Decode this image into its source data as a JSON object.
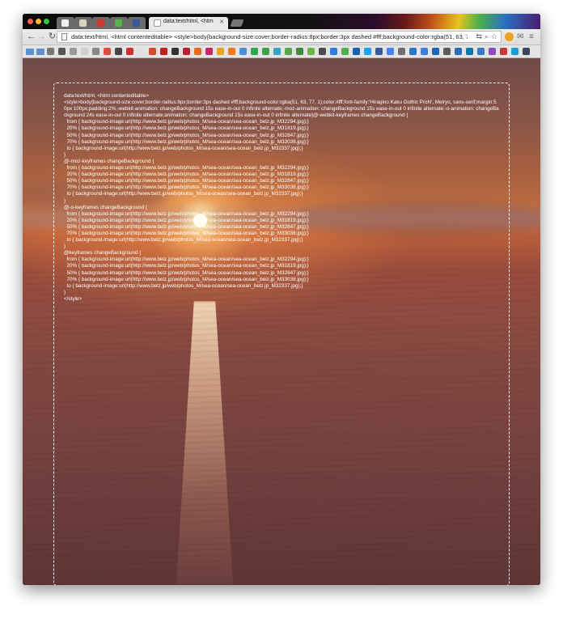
{
  "browser": {
    "tabs": [
      {
        "label": ""
      },
      {
        "label": ""
      },
      {
        "label": ""
      },
      {
        "label": ""
      },
      {
        "label": ""
      },
      {
        "label": "data:text/html, <html con",
        "active": true
      }
    ],
    "url": "data:text/html, <html contenteditable> <style>body{background-size:cover;border-radius:8px;border:3px dashed #fff;background-color:rgba(51, 63, 77, 1..."
  },
  "page": {
    "code_lines": [
      "data:text/html, <html contenteditable>",
      "<style>body{background-size:cover;border-radius:8px;border:3px dashed #fff;background-color:rgba(51, 63, 77, 1);color:#fff;font-family:'Hiragino Kaku Gothic ProN', Meiryo, sans-serif;margin:50px 100px;padding:2%;-webkit-animation: changeBackground 15s ease-in-out 0 infinite alternate;-moz-animation: changeBackground 15s ease-in-out 0 infinite alternate;-o-animation: changeBackground 24s ease-in-out 0 infinite alternate;animation: changeBackground 15s ease-in-out 0 infinite alternate}@-webkit-keyframes changeBackground {",
      "  from { background-image:url(http://www.belz.jp/web/photos_M/sea-ocean/sea-ocean_belz.jp_M32294.jpg);}",
      "  20% { background-image:url(http://www.belz.jp/web/photos_M/sea-ocean/sea-ocean_belz.jp_M31819.jpg);}",
      "  50% { background-image:url(http://www.belz.jp/web/photos_M/sea-ocean/sea-ocean_belz.jp_M32847.jpg);}",
      "  70% { background-image:url(http://www.belz.jp/web/photos_M/sea-ocean/sea-ocean_belz.jp_M33038.jpg);}",
      "  to { background-image:url(http://www.belz.jp/web/photos_M/sea-ocean/sea-ocean_belz.jp_M32337.jpg);}",
      "}",
      "@-moz-keyframes changeBackground {",
      "  from { background-image:url(http://www.belz.jp/web/photos_M/sea-ocean/sea-ocean_belz.jp_M32294.jpg);}",
      "  20% { background-image:url(http://www.belz.jp/web/photos_M/sea-ocean/sea-ocean_belz.jp_M31819.jpg);}",
      "  50% { background-image:url(http://www.belz.jp/web/photos_M/sea-ocean/sea-ocean_belz.jp_M32847.jpg);}",
      "  70% { background-image:url(http://www.belz.jp/web/photos_M/sea-ocean/sea-ocean_belz.jp_M33038.jpg);}",
      "  to { background-image:url(http://www.belz.jp/web/photos_M/sea-ocean/sea-ocean_belz.jp_M32337.jpg);}",
      "}",
      "@-o-keyframes changeBackground {",
      "  from { background-image:url(http://www.belz.jp/web/photos_M/sea-ocean/sea-ocean_belz.jp_M32294.jpg);}",
      "  20% { background-image:url(http://www.belz.jp/web/photos_M/sea-ocean/sea-ocean_belz.jp_M31819.jpg);}",
      "  50% { background-image:url(http://www.belz.jp/web/photos_M/sea-ocean/sea-ocean_belz.jp_M32847.jpg);}",
      "  70% { background-image:url(http://www.belz.jp/web/photos_M/sea-ocean/sea-ocean_belz.jp_M33038.jpg);}",
      "  to { background-image:url(http://www.belz.jp/web/photos_M/sea-ocean/sea-ocean_belz.jp_M32337.jpg);}",
      "}",
      "@keyframes changeBackground {",
      "  from { background-image:url(http://www.belz.jp/web/photos_M/sea-ocean/sea-ocean_belz.jp_M32294.jpg);}",
      "  20% { background-image:url(http://www.belz.jp/web/photos_M/sea-ocean/sea-ocean_belz.jp_M31819.jpg);}",
      "  50% { background-image:url(http://www.belz.jp/web/photos_M/sea-ocean/sea-ocean_belz.jp_M32847.jpg);}",
      "  70% { background-image:url(http://www.belz.jp/web/photos_M/sea-ocean/sea-ocean_belz.jp_M33038.jpg);}",
      "  to { background-image:url(http://www.belz.jp/web/photos_M/sea-ocean/sea-ocean_belz.jp_M32337.jpg);}",
      "}",
      "</style>"
    ]
  },
  "icons": {
    "back": "back-arrow-icon",
    "forward": "forward-arrow-icon",
    "reload": "reload-icon",
    "page": "page-icon",
    "star": "bookmark-star-icon",
    "menu": "hamburger-menu-icon"
  },
  "colors": {
    "sky_top": "#6f4a48",
    "sun_glow": "#ffe6a0",
    "sea": "#7a4340",
    "editable_border": "#ffffff",
    "close": "#fc5f57",
    "minimize": "#fdbc2e",
    "maximize": "#33c748"
  }
}
